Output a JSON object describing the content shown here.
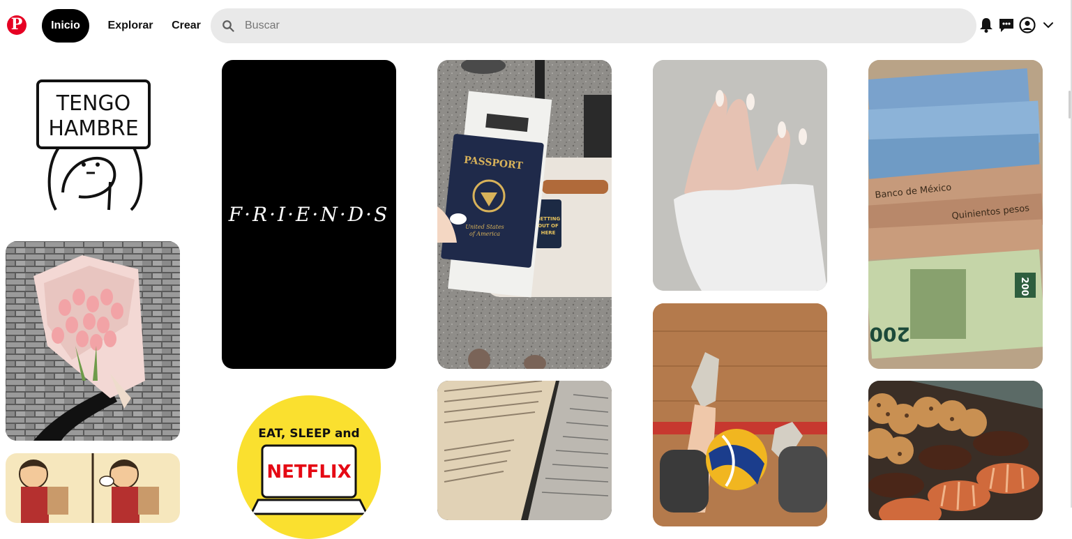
{
  "header": {
    "logo_letter": "P",
    "nav": {
      "home": "Inicio",
      "explore": "Explorar",
      "create": "Crear"
    },
    "search_placeholder": "Buscar",
    "icons": [
      "bell-icon",
      "messages-icon",
      "profile-icon",
      "chevron-down-icon"
    ],
    "brand_color": "#e60023"
  },
  "pins": {
    "tengo_hambre": {
      "line1": "TENGO",
      "line2": "HAMBRE"
    },
    "friends": {
      "title": "F·R·I·E·N·D·S"
    },
    "passport": {
      "title": "PASSPORT",
      "line1": "United States",
      "line2": "of America",
      "tag1": "GETTING",
      "tag2": "OUT OF",
      "tag3": "HERE"
    },
    "money": {
      "line1": "Banco de México",
      "line2": "Quinientos pesos",
      "value": "200"
    },
    "netflix": {
      "line1": "EAT, SLEEP and",
      "brand": "NETFLIX"
    }
  }
}
